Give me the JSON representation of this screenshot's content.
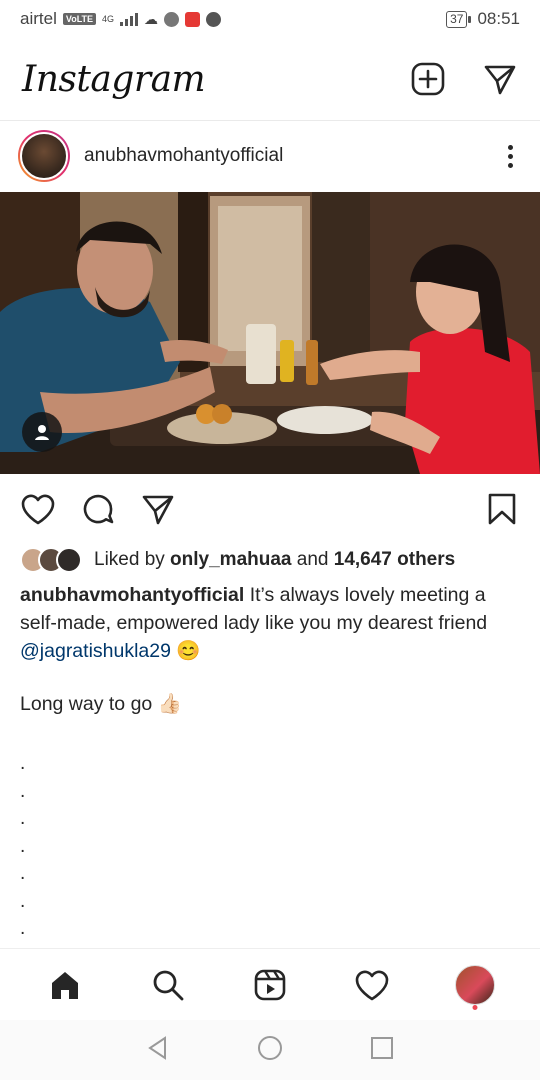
{
  "status_bar": {
    "carrier": "airtel",
    "volte": "VoLTE",
    "network": "4G",
    "battery": "37",
    "time": "08:51"
  },
  "header": {
    "logo": "Instagram",
    "icons": [
      "new-post-icon",
      "direct-message-icon"
    ]
  },
  "post": {
    "username": "anubhavmohantyofficial",
    "likes": {
      "prefix": "Liked by ",
      "liked_by": "only_mahuaa",
      "connector": " and ",
      "others": "14,647 others"
    },
    "caption": {
      "username": "anubhavmohantyofficial",
      "text": " It’s always lovely meeting a self-made, empowered lady like you my dearest friend ",
      "mention": "@jagratishukla29",
      "emoji": " 😊"
    },
    "line2": "Long way to go 👍🏻",
    "dots": ".\n.\n.\n.\n.\n.\n."
  },
  "action_icons": [
    "like-icon",
    "comment-icon",
    "share-icon",
    "save-icon"
  ],
  "bottom_nav": [
    "home-icon",
    "search-icon",
    "reels-icon",
    "activity-icon",
    "profile-avatar"
  ],
  "colors": {
    "text": "#262626",
    "mention": "#00376b",
    "notification": "#ed4956"
  }
}
